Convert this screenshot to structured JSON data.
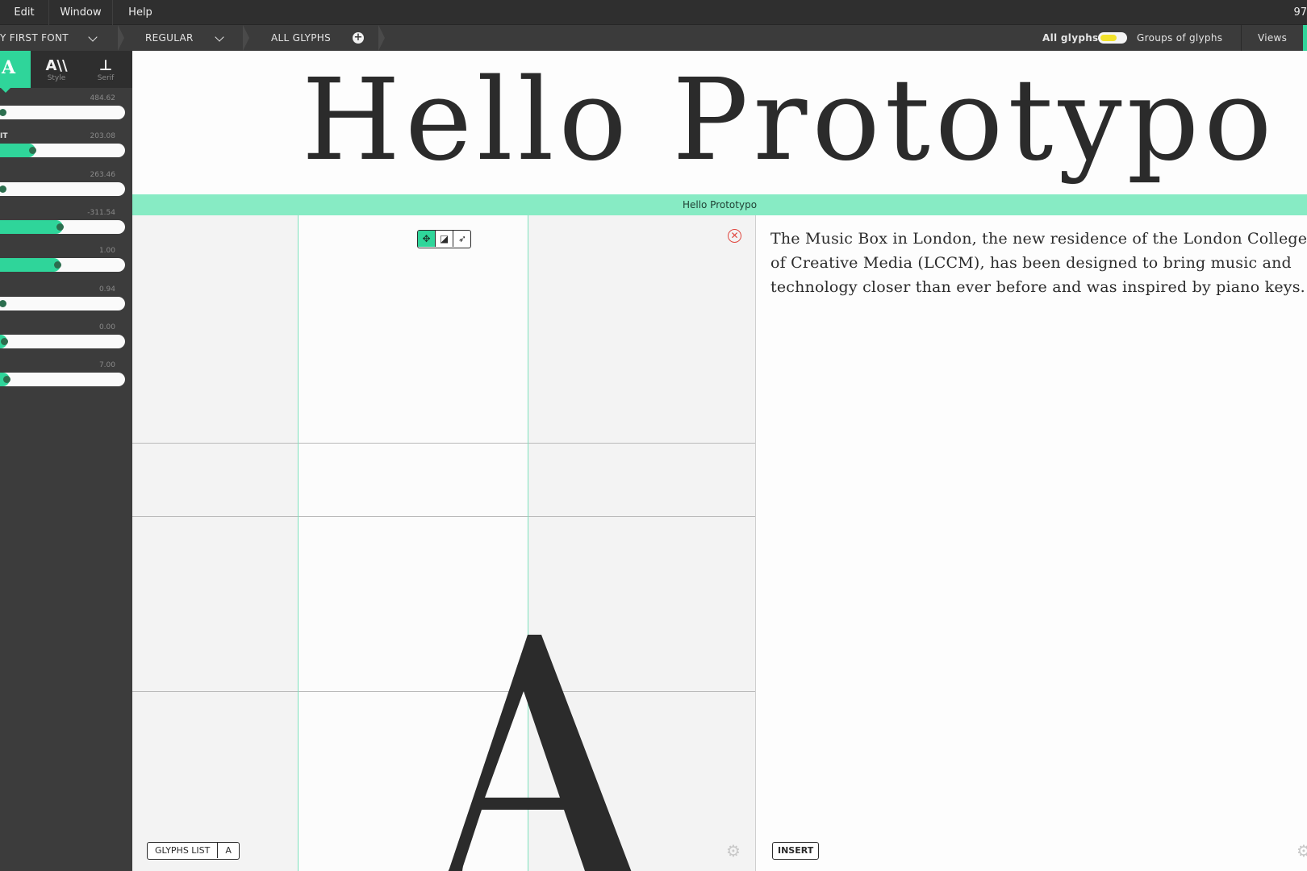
{
  "menu": {
    "items": [
      "Edit",
      "Window",
      "Help"
    ],
    "right_text": "97"
  },
  "toolbar": {
    "font_name": "Y FIRST FONT",
    "variant": "REGULAR",
    "glyph_set": "ALL GLYPHS",
    "toggle_left_label": "All glyphs",
    "toggle_right_label": "Groups of glyphs",
    "views_label": "Views"
  },
  "sidebar": {
    "tabs": [
      {
        "icon": "A",
        "label": "",
        "active": true
      },
      {
        "icon": "A\\\\",
        "label": "Style",
        "active": false
      },
      {
        "icon": "⊥",
        "label": "Serif",
        "active": false
      }
    ],
    "sliders": [
      {
        "label": "",
        "value_text": "484.62",
        "fill": 0.0
      },
      {
        "label": "IT",
        "value_text": "203.08",
        "fill": 0.26
      },
      {
        "label": "",
        "value_text": "263.46",
        "fill": 0.0
      },
      {
        "label": "",
        "value_text": "-311.54",
        "fill": 0.48
      },
      {
        "label": "",
        "value_text": "1.00",
        "fill": 0.46
      },
      {
        "label": "",
        "value_text": "0.94",
        "fill": 0.0
      },
      {
        "label": "",
        "value_text": "0.00",
        "fill": 0.03
      },
      {
        "label": "",
        "value_text": "7.00",
        "fill": 0.05
      }
    ]
  },
  "preview": {
    "text": "Hello Prototypo"
  },
  "titlebar": {
    "text": "Hello Prototypo"
  },
  "glyph_view": {
    "glyph": "A",
    "glyphs_list_label": "GLYPHS LIST",
    "current_glyph": "A",
    "close_symbol": "✕",
    "tools": [
      "move",
      "shape",
      "pointer"
    ]
  },
  "text_view": {
    "content": "The Music Box in London, the new residence of the London College of Creative Media (LCCM), has been designed to bring music and technology closer than ever before and was inspired by piano keys.",
    "insert_label": "INSERT"
  },
  "colors": {
    "accent": "#2fd59a",
    "accent_light": "#87ebc4",
    "sidebar_bg": "#3c3c3c",
    "toolbar_bg": "#3b3b3b",
    "menubar_bg": "#2f2f2f",
    "toggle_knob": "#f2e22a",
    "close_red": "#e0473f"
  },
  "icons": [
    "plus-circle-icon",
    "chevron-down-icon",
    "move-icon",
    "shape-icon",
    "pointer-icon",
    "close-icon",
    "gear-icon",
    "func-icon",
    "style-icon",
    "serif-icon"
  ]
}
